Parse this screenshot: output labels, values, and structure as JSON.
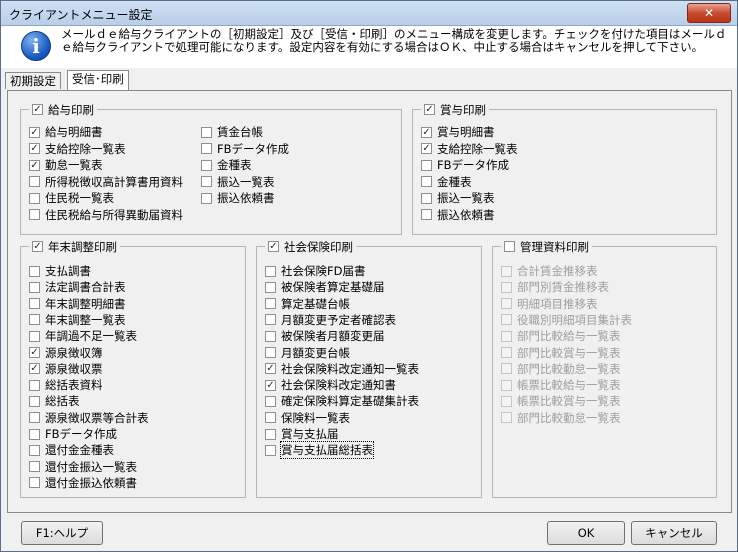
{
  "window": {
    "title": "クライアントメニュー設定",
    "close_label": "✕"
  },
  "info": {
    "icon": "info-icon",
    "message": "メールｄｅ給与クライアントの［初期設定］及び［受信・印刷］のメニュー構成を変更します。チェックを付けた項目はメールｄｅ給与クライアントで処理可能になります。設定内容を有効にする場合はＯＫ、中止する場合はキャンセルを押して下さい。"
  },
  "tabs": [
    {
      "label": "初期設定",
      "active": false
    },
    {
      "label": "受信･印刷",
      "active": true
    }
  ],
  "groups": {
    "kyuyo": {
      "title": "給与印刷",
      "checked": true,
      "items": [
        {
          "label": "給与明細書",
          "checked": true
        },
        {
          "label": "支給控除一覧表",
          "checked": true
        },
        {
          "label": "勤怠一覧表",
          "checked": true
        },
        {
          "label": "所得税徴収高計算書用資料",
          "checked": false
        },
        {
          "label": "住民税一覧表",
          "checked": false
        },
        {
          "label": "住民税給与所得異動届資料",
          "checked": false
        },
        {
          "label": "賃金台帳",
          "checked": false
        },
        {
          "label": "FBデータ作成",
          "checked": false
        },
        {
          "label": "金種表",
          "checked": false
        },
        {
          "label": "振込一覧表",
          "checked": false
        },
        {
          "label": "振込依頼書",
          "checked": false
        }
      ]
    },
    "shoyo": {
      "title": "賞与印刷",
      "checked": true,
      "items": [
        {
          "label": "賞与明細書",
          "checked": true
        },
        {
          "label": "支給控除一覧表",
          "checked": true
        },
        {
          "label": "FBデータ作成",
          "checked": false
        },
        {
          "label": "金種表",
          "checked": false
        },
        {
          "label": "振込一覧表",
          "checked": false
        },
        {
          "label": "振込依頼書",
          "checked": false
        }
      ]
    },
    "nenmatsu": {
      "title": "年末調整印刷",
      "checked": true,
      "items": [
        {
          "label": "支払調書",
          "checked": false
        },
        {
          "label": "法定調書合計表",
          "checked": false
        },
        {
          "label": "年末調整明細書",
          "checked": false
        },
        {
          "label": "年末調整一覧表",
          "checked": false
        },
        {
          "label": "年調過不足一覧表",
          "checked": false
        },
        {
          "label": "源泉徴収簿",
          "checked": true
        },
        {
          "label": "源泉徴収票",
          "checked": true
        },
        {
          "label": "総括表資料",
          "checked": false
        },
        {
          "label": "総括表",
          "checked": false
        },
        {
          "label": "源泉徴収票等合計表",
          "checked": false
        },
        {
          "label": "FBデータ作成",
          "checked": false
        },
        {
          "label": "還付金金種表",
          "checked": false
        },
        {
          "label": "還付金振込一覧表",
          "checked": false
        },
        {
          "label": "還付金振込依頼書",
          "checked": false
        }
      ]
    },
    "shakai": {
      "title": "社会保険印刷",
      "checked": true,
      "items": [
        {
          "label": "社会保険FD届書",
          "checked": false
        },
        {
          "label": "被保険者算定基礎届",
          "checked": false
        },
        {
          "label": "算定基礎台帳",
          "checked": false
        },
        {
          "label": "月額変更予定者確認表",
          "checked": false
        },
        {
          "label": "被保険者月額変更届",
          "checked": false
        },
        {
          "label": "月額変更台帳",
          "checked": false
        },
        {
          "label": "社会保険料改定通知一覧表",
          "checked": true
        },
        {
          "label": "社会保険料改定通知書",
          "checked": true
        },
        {
          "label": "確定保険料算定基礎集計表",
          "checked": false
        },
        {
          "label": "保険料一覧表",
          "checked": false
        },
        {
          "label": "賞与支払届",
          "checked": false
        },
        {
          "label": "賞与支払届総括表",
          "checked": false
        }
      ]
    },
    "kanri": {
      "title": "管理資料印刷",
      "checked": false,
      "items": [
        {
          "label": "合計賃金推移表",
          "checked": false
        },
        {
          "label": "部門別賃金推移表",
          "checked": false
        },
        {
          "label": "明細項目推移表",
          "checked": false
        },
        {
          "label": "役職別明細項目集計表",
          "checked": false
        },
        {
          "label": "部門比較給与一覧表",
          "checked": false
        },
        {
          "label": "部門比較賞与一覧表",
          "checked": false
        },
        {
          "label": "部門比較勤怠一覧表",
          "checked": false
        },
        {
          "label": "帳票比較給与一覧表",
          "checked": false
        },
        {
          "label": "帳票比較賞与一覧表",
          "checked": false
        },
        {
          "label": "部門比較勤怠一覧表",
          "checked": false
        }
      ]
    }
  },
  "buttons": {
    "help": "F1:ヘルプ",
    "ok": "OK",
    "cancel": "キャンセル"
  }
}
